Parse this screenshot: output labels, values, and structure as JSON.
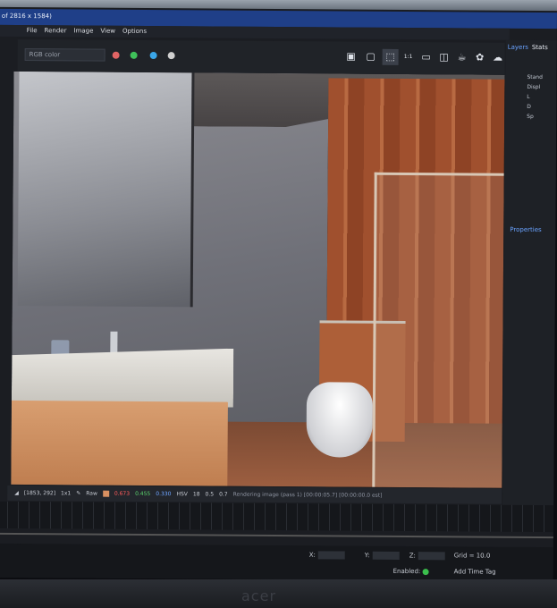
{
  "window": {
    "title": "of 2816 x 1584)"
  },
  "menu": [
    "File",
    "Render",
    "Image",
    "View",
    "Options"
  ],
  "toolbar": {
    "channel": "RGB color",
    "dots": [
      "#e06464",
      "#3fc15a",
      "#3aa6e8",
      "#d0d0d0"
    ],
    "buttons": [
      "save-icon",
      "copy-icon",
      "region-icon",
      "1:1",
      "display-icon",
      "camera-icon",
      "teapot-icon",
      "teapot-gear-icon",
      "cloud-icon"
    ]
  },
  "status": {
    "pixel": "[1853, 292]",
    "zoom": "1x1",
    "raw": "Raw",
    "r": "0.673",
    "g": "0.455",
    "b": "0.330",
    "mode": "HSV",
    "h": "18",
    "s": "0.5",
    "v": "0.7",
    "message": "Rendering image (pass 1) [00:00:05.7] [00:00:00.0 est]"
  },
  "panel": {
    "tab_layers": "Layers",
    "tab_stats": "Stats",
    "layers": [
      "Stand",
      "Displ",
      "L",
      "D",
      "Sp"
    ],
    "properties": "Properties"
  },
  "bottom": {
    "x_label": "X:",
    "y_label": "Y:",
    "z_label": "Z:",
    "grid": "Grid = 10.0",
    "enabled": "Enabled:",
    "add_tag": "Add Time Tag"
  },
  "brand": "acer"
}
